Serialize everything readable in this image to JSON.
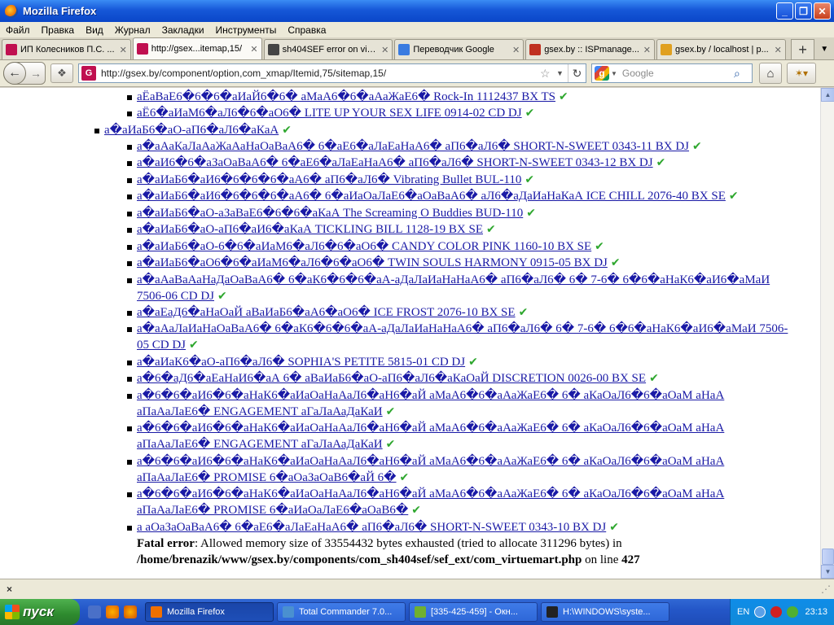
{
  "window": {
    "title": "Mozilla Firefox"
  },
  "menu": [
    "Файл",
    "Правка",
    "Вид",
    "Журнал",
    "Закладки",
    "Инструменты",
    "Справка"
  ],
  "tabs": [
    {
      "label": "ИП Колесников П.С. ...",
      "icon": "site-favicon",
      "color": "#c01050"
    },
    {
      "label": "http://gsex...itemap,15/",
      "icon": "site-favicon",
      "color": "#c01050"
    },
    {
      "label": "sh404SEF error on virt...",
      "icon": "gear-favicon",
      "color": "#444444"
    },
    {
      "label": "Переводчик Google",
      "icon": "translate-favicon",
      "color": "#3a7be0"
    },
    {
      "label": "gsex.by :: ISPmanage...",
      "icon": "isp-favicon",
      "color": "#c03020"
    },
    {
      "label": "gsex.by / localhost | p...",
      "icon": "pma-favicon",
      "color": "#e0a020"
    }
  ],
  "nav": {
    "url": "http://gsex.by/component/option,com_xmap/Itemid,75/sitemap,15/",
    "site_icon_letter": "G",
    "search_placeholder": "Google"
  },
  "content": {
    "top_items": [
      "аЁаВаЕ6�6�6�аИаЙ6�6� аМаА6�6�аАаЖаЕ6� Rock-In 1112437 BX TS",
      "аЁ6�аИаМ6�аЛ6�6�аО6� LITE UP YOUR SEX LIFE 0914-02 CD DJ"
    ],
    "category": "а�аИаБ6�аО-аП6�аЛ6�аКаА",
    "items": [
      "а�аАаКаЛаАаЖаАаНаОаВаА6� 6�аЕ6�аЛаЕаНаА6� аП6�аЛ6� SHORT-N-SWEET 0343-11 BX DJ",
      "а�аИ6�6�аЗаОаВаА6� 6�аЕ6�аЛаЕаНаА6� аП6�аЛ6� SHORT-N-SWEET 0343-12 BX DJ",
      "а�аИаБ6�аИ6�6�6�6�аА6� аП6�аЛ6� Vibrating Bullet BUL-110",
      "а�аИаБ6�аИ6�6�6�6�аА6� 6�аИаОаЛаЕ6�аОаВаА6� аЛ6�аДаИаНаКаА ICE CHILL 2076-40 BX SE",
      "а�аИаБ6�аО-аЗаВаЕ6�6�6�аКаА The Screaming O Buddies BUD-110",
      "а�аИаБ6�аО-аП6�аИ6�аКаА TICKLING BILL 1128-19 BX SE",
      "а�аИаБ6�аО-6�6�аИаМ6�аЛ6�6�аО6� CANDY COLOR PINK 1160-10 BX SE",
      "а�аИаБ6�аО6�6�аИаМ6�аЛ6�6�аО6� TWIN SOULS HARMONY 0915-05 BX DJ",
      "а�аАаВаАаНаДаОаВаА6� 6�аК6�6�6�аА-аДаЛаИаНаНаА6� аП6�аЛ6� 6� 7-6� 6�6�аНаК6�аИ6�аМаИ 7506-06 CD DJ",
      "а�аЕаД6�аНаОаЙ аВаИаБ6�аА6�аО6� ICE FROST 2076-10 BX SE",
      "а�аАаЛаИаНаОаВаА6� 6�аК6�6�6�аА-аДаЛаИаНаНаА6� аП6�аЛ6� 6� 7-6� 6�6�аНаК6�аИ6�аМаИ 7506-05 CD DJ",
      "а�аИаК6�аО-аП6�аЛ6� SOPHIA'S PETITE 5815-01 CD DJ",
      "а�6�аД6�аЕаНаИ6�аА 6� аВаИаБ6�аО-аП6�аЛ6�аКаОаЙ DISCRETION 0026-00 BX SE",
      "а�6�6�аИ6�6�аНаК6�аИаОаНаАаЛ6�аН6�аЙ аМаА6�6�аАаЖаЕ6� 6� аКаОаЛ6�6�аОаМ аНаА аПаАаЛаЕ6� ENGAGEMENT аГаЛаАаДаКаИ",
      "а�6�6�аИ6�6�аНаК6�аИаОаНаАаЛ6�аН6�аЙ аМаА6�6�аАаЖаЕ6� 6� аКаОаЛ6�6�аОаМ аНаА аПаАаЛаЕ6� ENGAGEMENT аГаЛаАаДаКаИ",
      "а�6�6�аИ6�6�аНаК6�аИаОаНаАаЛ6�аН6�аЙ аМаА6�6�аАаЖаЕ6� 6� аКаОаЛ6�6�аОаМ аНаА аПаАаЛаЕ6� PROMISE 6�аОаЗаОаВ6�аЙ 6�",
      "а�6�6�аИ6�6�аНаК6�аИаОаНаАаЛ6�аН6�аЙ аМаА6�6�аАаЖаЕ6� 6� аКаОаЛ6�6�аОаМ аНаА аПаАаЛаЕ6� PROMISE 6�аИаОаЛаЕ6�аОаВ6�",
      "а аОаЗаОаВаА6� 6�аЕ6�аЛаЕаНаА6� аП6�аЛ6� SHORT-N-SWEET 0343-10 BX DJ"
    ],
    "error": {
      "label": "Fatal error",
      "text": ": Allowed memory size of 33554432 bytes exhausted (tried to allocate 311296 bytes) in ",
      "path": "/home/brenazik/www/gsex.by/components/com_sh404sef/sef_ext/com_virtuemart.php",
      "line_text": " on line ",
      "line": "427"
    }
  },
  "status": {
    "close": "×"
  },
  "taskbar": {
    "start": "пуск",
    "items": [
      {
        "label": "Mozilla Firefox",
        "color": "#f07000"
      },
      {
        "label": "Total Commander 7.0...",
        "color": "#4a90d0"
      },
      {
        "label": "[335-425-459] - Окн...",
        "color": "#70b030"
      },
      {
        "label": "H:\\WINDOWS\\syste...",
        "color": "#222222"
      }
    ],
    "lang": "EN",
    "clock": "23:13"
  },
  "colors": {
    "link": "#1a1aa6",
    "check": "#2ea72e"
  }
}
